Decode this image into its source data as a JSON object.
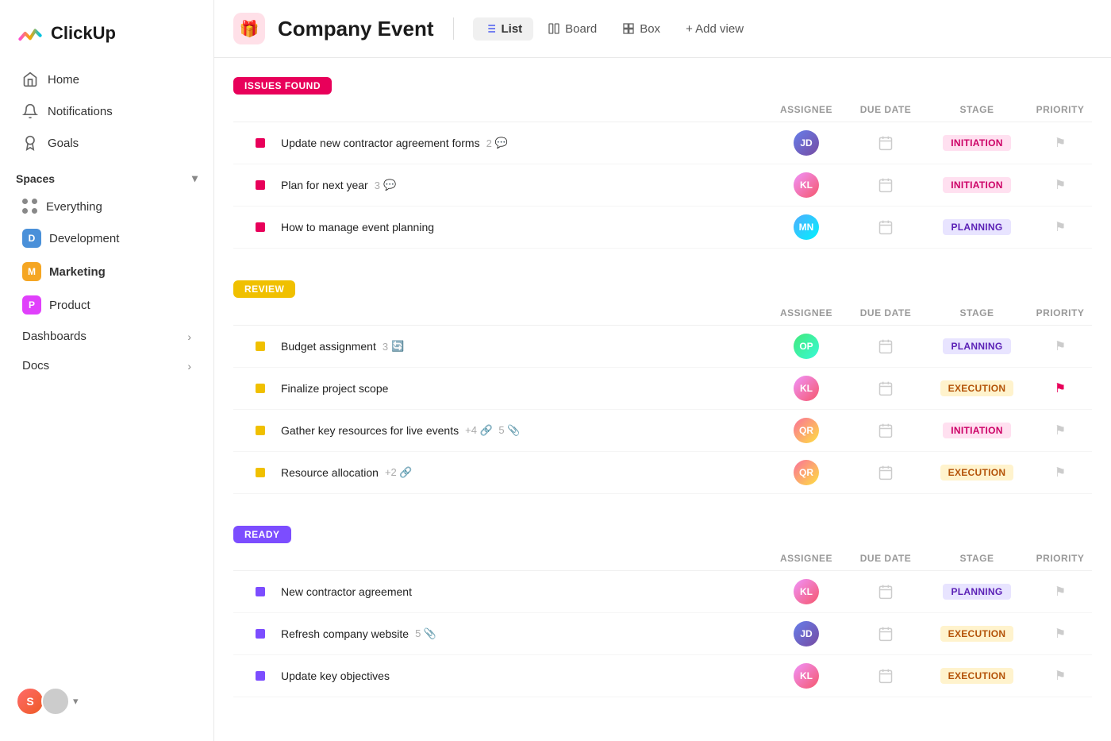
{
  "sidebar": {
    "logo_text": "ClickUp",
    "nav": [
      {
        "id": "home",
        "label": "Home",
        "icon": "home"
      },
      {
        "id": "notifications",
        "label": "Notifications",
        "icon": "bell"
      },
      {
        "id": "goals",
        "label": "Goals",
        "icon": "trophy"
      }
    ],
    "spaces_label": "Spaces",
    "spaces": [
      {
        "id": "everything",
        "label": "Everything",
        "type": "everything"
      },
      {
        "id": "development",
        "label": "Development",
        "color": "#4a90d9",
        "letter": "D"
      },
      {
        "id": "marketing",
        "label": "Marketing",
        "color": "#f5a623",
        "letter": "M",
        "active": true
      },
      {
        "id": "product",
        "label": "Product",
        "color": "#e040fb",
        "letter": "P"
      }
    ],
    "sections": [
      {
        "id": "dashboards",
        "label": "Dashboards"
      },
      {
        "id": "docs",
        "label": "Docs"
      }
    ]
  },
  "header": {
    "event_icon": "🎁",
    "title": "Company Event",
    "views": [
      {
        "id": "list",
        "label": "List",
        "active": true
      },
      {
        "id": "board",
        "label": "Board",
        "active": false
      },
      {
        "id": "box",
        "label": "Box",
        "active": false
      }
    ],
    "add_view_label": "+ Add view"
  },
  "columns": {
    "task": "",
    "assignee": "ASSIGNEE",
    "due_date": "DUE DATE",
    "stage": "STAGE",
    "priority": "PRIORITY"
  },
  "groups": [
    {
      "id": "issues",
      "label": "ISSUES FOUND",
      "type": "issues",
      "tasks": [
        {
          "id": 1,
          "name": "Update new contractor agreement forms",
          "meta": "2",
          "meta_icon": "chat",
          "avatar_class": "av1",
          "avatar_initials": "JD",
          "stage": "INITIATION",
          "stage_type": "initiation",
          "priority": "flag"
        },
        {
          "id": 2,
          "name": "Plan for next year",
          "meta": "3",
          "meta_icon": "chat",
          "avatar_class": "av2",
          "avatar_initials": "KL",
          "stage": "INITIATION",
          "stage_type": "initiation",
          "priority": "flag"
        },
        {
          "id": 3,
          "name": "How to manage event planning",
          "meta": "",
          "meta_icon": "",
          "avatar_class": "av3",
          "avatar_initials": "MN",
          "stage": "PLANNING",
          "stage_type": "planning",
          "priority": "flag"
        }
      ]
    },
    {
      "id": "review",
      "label": "REVIEW",
      "type": "review",
      "tasks": [
        {
          "id": 4,
          "name": "Budget assignment",
          "meta": "3",
          "meta_icon": "refresh",
          "avatar_class": "av4",
          "avatar_initials": "OP",
          "stage": "PLANNING",
          "stage_type": "planning",
          "priority": "flag"
        },
        {
          "id": 5,
          "name": "Finalize project scope",
          "meta": "",
          "meta_icon": "",
          "avatar_class": "av2",
          "avatar_initials": "KL",
          "stage": "EXECUTION",
          "stage_type": "execution",
          "priority": "flag-red"
        },
        {
          "id": 6,
          "name": "Gather key resources for live events",
          "meta": "+4 🔗  5 📎",
          "meta_icon": "",
          "avatar_class": "av5",
          "avatar_initials": "QR",
          "stage": "INITIATION",
          "stage_type": "initiation",
          "priority": "flag"
        },
        {
          "id": 7,
          "name": "Resource allocation",
          "meta": "+2 🔗",
          "meta_icon": "",
          "avatar_class": "av5",
          "avatar_initials": "QR",
          "stage": "EXECUTION",
          "stage_type": "execution",
          "priority": "flag"
        }
      ]
    },
    {
      "id": "ready",
      "label": "READY",
      "type": "ready",
      "tasks": [
        {
          "id": 8,
          "name": "New contractor agreement",
          "meta": "",
          "meta_icon": "",
          "avatar_class": "av2",
          "avatar_initials": "KL",
          "stage": "PLANNING",
          "stage_type": "planning",
          "priority": "flag"
        },
        {
          "id": 9,
          "name": "Refresh company website",
          "meta": "5 📎",
          "meta_icon": "",
          "avatar_class": "av1",
          "avatar_initials": "JD",
          "stage": "EXECUTION",
          "stage_type": "execution",
          "priority": "flag"
        },
        {
          "id": 10,
          "name": "Update key objectives",
          "meta": "",
          "meta_icon": "",
          "avatar_class": "av2",
          "avatar_initials": "KL",
          "stage": "EXECUTION",
          "stage_type": "execution",
          "priority": "flag"
        }
      ]
    }
  ]
}
